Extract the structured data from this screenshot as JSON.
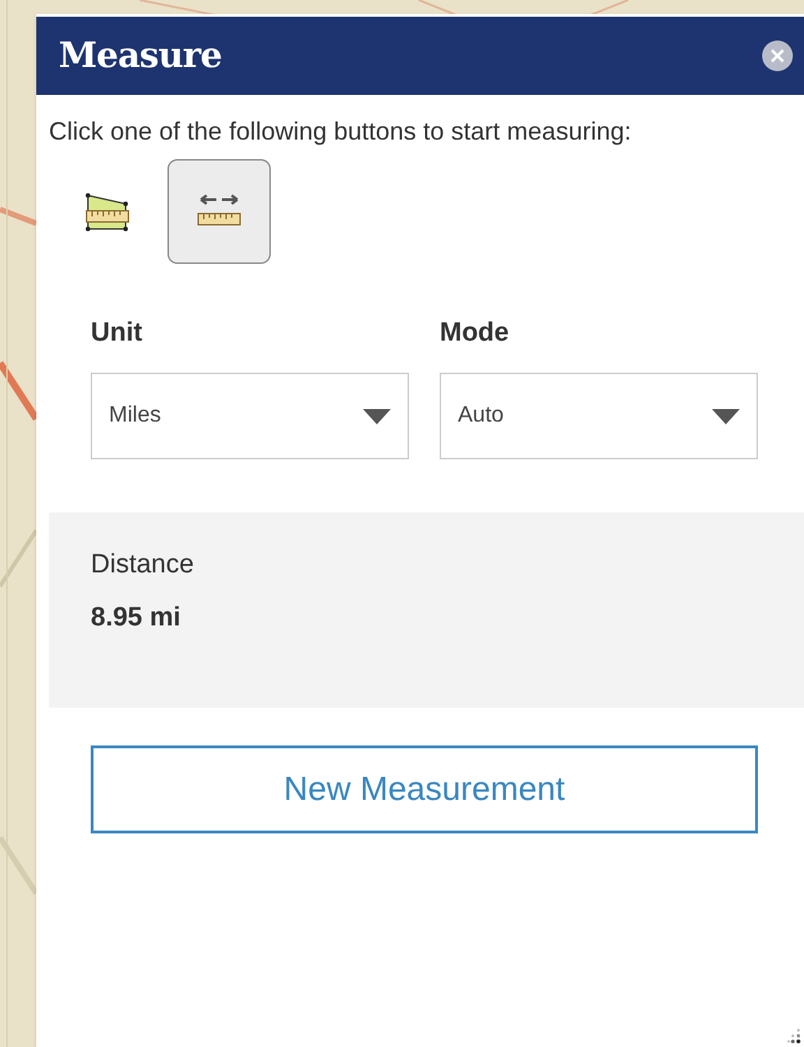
{
  "panel": {
    "title": "Measure",
    "instruction": "Click one of the following buttons to start measuring:"
  },
  "tools": [
    {
      "kind": "area",
      "selected": false
    },
    {
      "kind": "distance",
      "selected": true
    }
  ],
  "selects": [
    {
      "label": "Unit",
      "value": "Miles"
    },
    {
      "label": "Mode",
      "value": "Auto"
    }
  ],
  "result": {
    "label": "Distance",
    "value": "8.95 mi"
  },
  "button": "New Measurement"
}
